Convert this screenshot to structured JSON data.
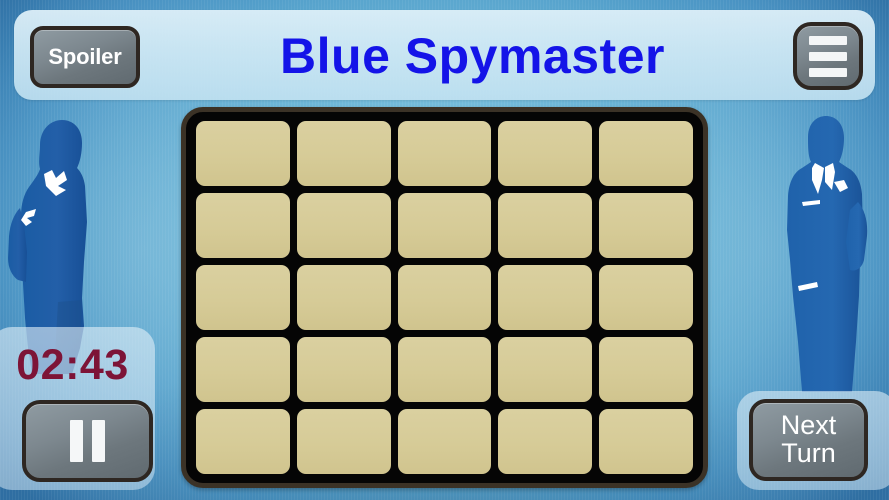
{
  "app": {
    "title": "Blue Spymaster",
    "title_color": "#1414e8",
    "background_color": "#6ab4d6"
  },
  "topbar": {
    "spoiler_label": "Spoiler",
    "menu_icon": "hamburger-menu-icon"
  },
  "board": {
    "rows": 5,
    "columns": 5,
    "card_color": "#d6cb97",
    "frame_color": "#3b3226",
    "cards": [
      {
        "label": ""
      },
      {
        "label": ""
      },
      {
        "label": ""
      },
      {
        "label": ""
      },
      {
        "label": ""
      },
      {
        "label": ""
      },
      {
        "label": ""
      },
      {
        "label": ""
      },
      {
        "label": ""
      },
      {
        "label": ""
      },
      {
        "label": ""
      },
      {
        "label": ""
      },
      {
        "label": ""
      },
      {
        "label": ""
      },
      {
        "label": ""
      },
      {
        "label": ""
      },
      {
        "label": ""
      },
      {
        "label": ""
      },
      {
        "label": ""
      },
      {
        "label": ""
      },
      {
        "label": ""
      },
      {
        "label": ""
      },
      {
        "label": ""
      },
      {
        "label": ""
      },
      {
        "label": ""
      }
    ]
  },
  "timer": {
    "value": "02:43",
    "color": "#7d1437",
    "pause_icon": "pause-icon"
  },
  "next_turn": {
    "line1": "Next",
    "line2": "Turn"
  },
  "decor": {
    "left_silhouette": "female-spy-silhouette",
    "right_silhouette": "male-spy-silhouette",
    "silhouette_color": "#1e63ab"
  }
}
